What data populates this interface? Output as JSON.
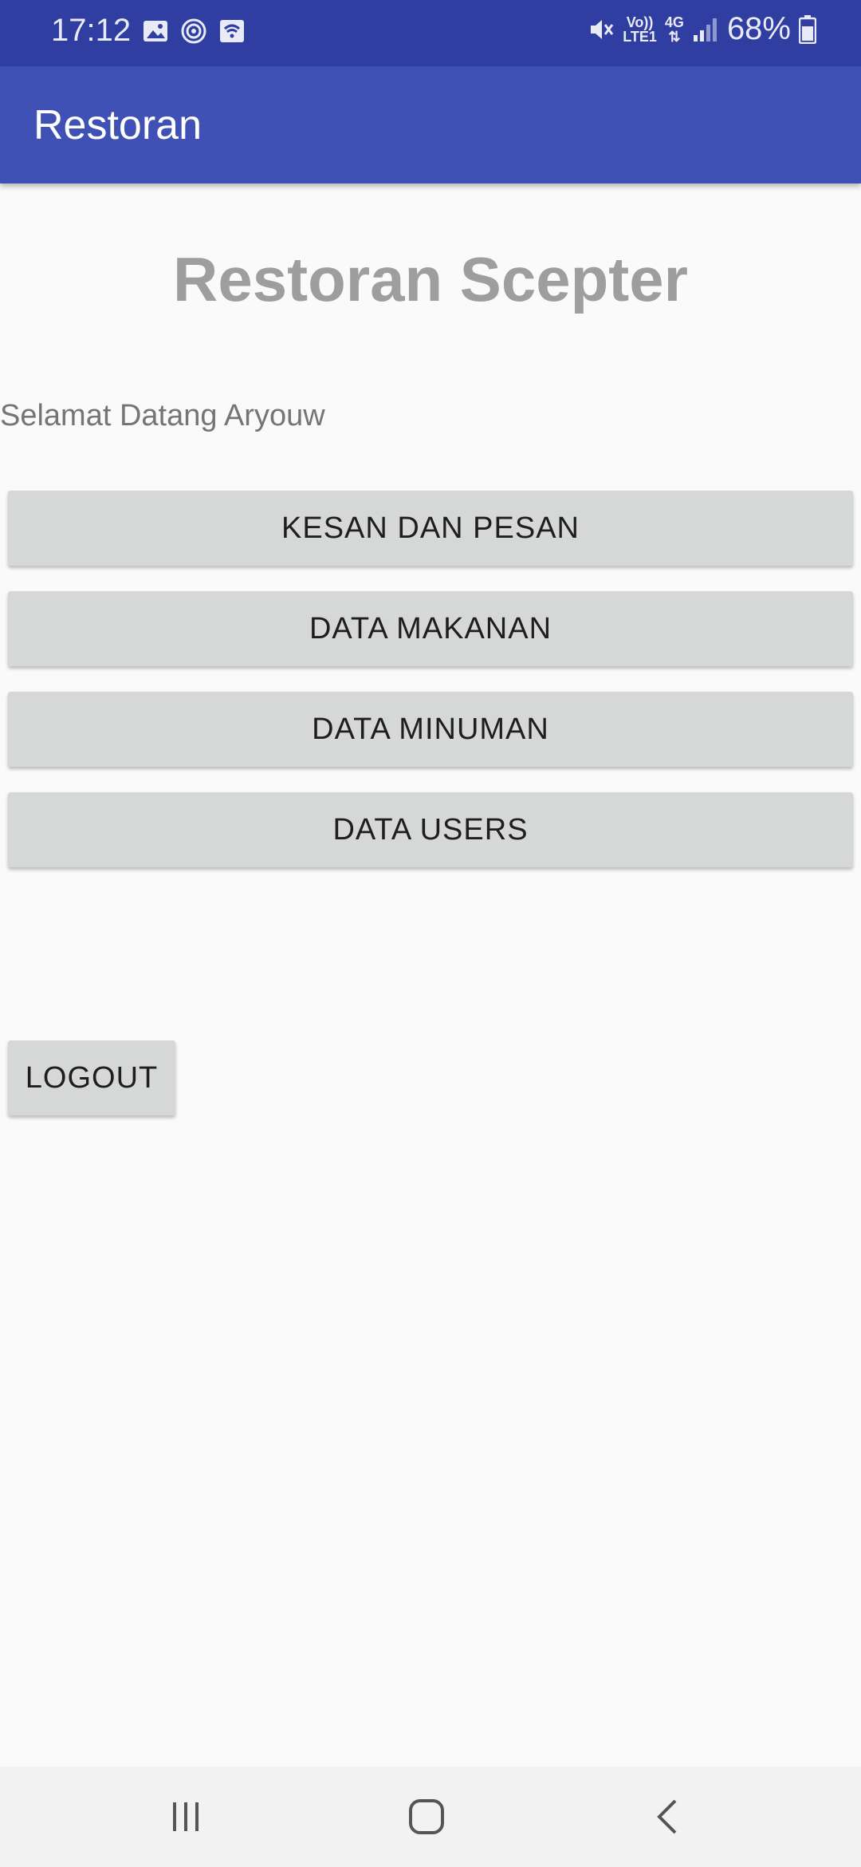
{
  "status_bar": {
    "time": "17:12",
    "battery": "68%",
    "network_label_top": "Vo))",
    "network_label_bottom": "LTE1",
    "network_type": "4G",
    "icons_left": [
      "gallery-icon",
      "sync-icon",
      "wifi-hotspot-icon"
    ],
    "icons_right": [
      "mute-icon",
      "volte-icon",
      "data-arrows-icon",
      "signal-icon",
      "battery-icon"
    ]
  },
  "app_bar": {
    "title": "Restoran"
  },
  "main": {
    "title": "Restoran Scepter",
    "welcome": "Selamat Datang Aryouw",
    "buttons": [
      {
        "label": "KESAN DAN PESAN"
      },
      {
        "label": "DATA MAKANAN"
      },
      {
        "label": "DATA MINUMAN"
      },
      {
        "label": "DATA USERS"
      }
    ],
    "logout_label": "LOGOUT"
  },
  "nav_bar": {
    "items": [
      "recent-apps-icon",
      "home-icon",
      "back-icon"
    ]
  },
  "colors": {
    "status_bar": "#2f3ea0",
    "app_bar": "#3f51b5",
    "background": "#fafafa",
    "button": "#d6d7d7",
    "title_text": "#9e9e9e"
  }
}
